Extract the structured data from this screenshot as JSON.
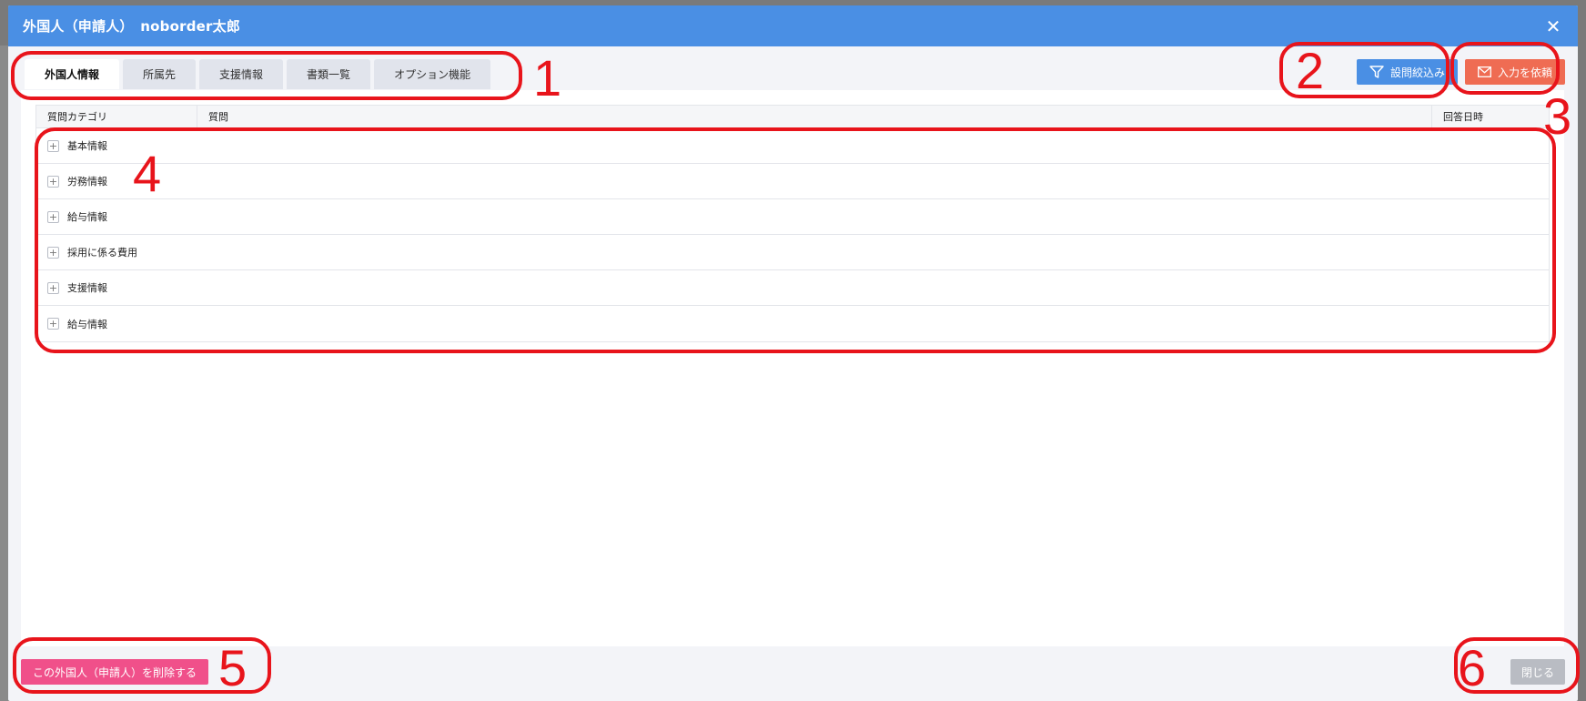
{
  "modal": {
    "title": "外国人（申請人）　noborder太郎",
    "close_icon": "close-icon"
  },
  "tabs": [
    {
      "label": "外国人情報",
      "active": true
    },
    {
      "label": "所属先",
      "active": false
    },
    {
      "label": "支援情報",
      "active": false
    },
    {
      "label": "書類一覧",
      "active": false
    },
    {
      "label": "オプション機能",
      "active": false
    }
  ],
  "actions": {
    "filter_label": "設問絞込み",
    "filter_icon": "funnel-icon",
    "request_label": "入力を依頼",
    "request_icon": "envelope-icon"
  },
  "table": {
    "columns": [
      "質問カテゴリ",
      "質問",
      "回答日時"
    ],
    "rows": [
      "基本情報",
      "労務情報",
      "給与情報",
      "採用に係る費用",
      "支援情報",
      "給与情報"
    ]
  },
  "footer": {
    "delete_label": "この外国人（申請人）を削除する",
    "close_label": "閉じる"
  },
  "annotations": [
    "1",
    "2",
    "3",
    "4",
    "5",
    "6"
  ],
  "colors": {
    "header": "#4a8fe4",
    "filter_button": "#4a8fe4",
    "request_button": "#ef6c53",
    "delete_button": "#f0508a",
    "close_button": "#b9bcc3",
    "annotation": "#e8141b"
  }
}
